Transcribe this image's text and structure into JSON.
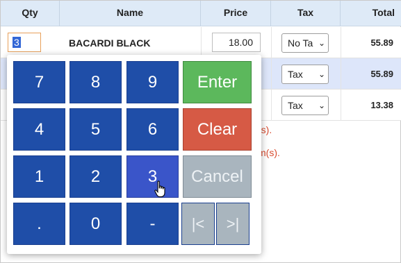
{
  "table": {
    "headers": {
      "qty": "Qty",
      "name": "Name",
      "price": "Price",
      "tax": "Tax",
      "total": "Total"
    },
    "rows": [
      {
        "qty": "3",
        "name": "BACARDI BLACK",
        "price": "18.00",
        "tax": "No Ta",
        "total": "55.89"
      },
      {
        "tax": "Tax",
        "total": "55.89"
      },
      {
        "tax": "Tax",
        "total": "13.38"
      }
    ]
  },
  "messages": [
    "(s).",
    "m(s)."
  ],
  "keypad": {
    "keys": {
      "k7": "7",
      "k8": "8",
      "k9": "9",
      "k4": "4",
      "k5": "5",
      "k6": "6",
      "k1": "1",
      "k2": "2",
      "k3": "3",
      "dot": ".",
      "k0": "0",
      "minus": "-",
      "enter": "Enter",
      "clear": "Clear",
      "cancel": "Cancel",
      "prev": "|<",
      "next": ">|"
    },
    "pressed_key": "3"
  },
  "colors": {
    "key_blue": "#1f4ea8",
    "enter_green": "#5cb85c",
    "clear_red": "#d65a45",
    "cancel_gray": "#a9b5be",
    "header_bg": "#deeaf7",
    "selected_row_bg": "#dde6fa",
    "message_red": "#d84a2e"
  },
  "icons": {
    "cursor": "hand-pointer-icon",
    "dropdown": "chevron-down-icon"
  }
}
